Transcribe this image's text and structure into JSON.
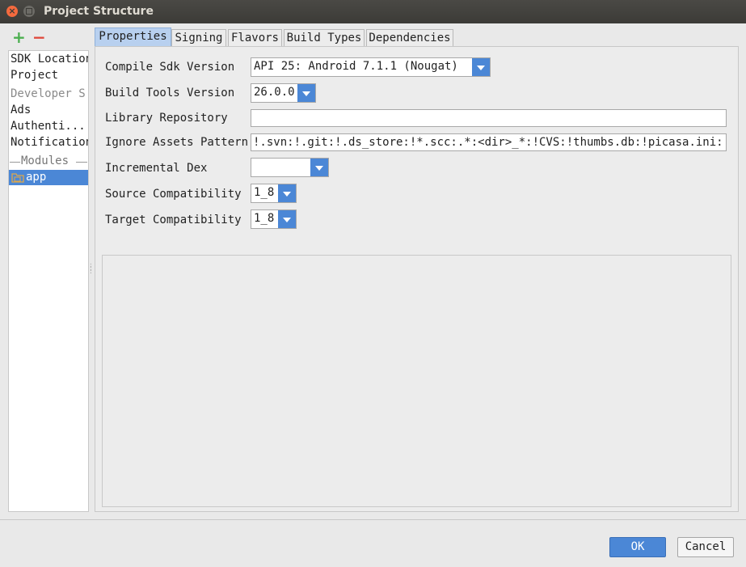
{
  "window": {
    "title": "Project Structure"
  },
  "toolbar": {
    "add": "+",
    "remove": "−"
  },
  "sidebar": {
    "items": [
      {
        "label": "SDK Location"
      },
      {
        "label": "Project"
      },
      {
        "label": "Developer S"
      },
      {
        "label": "Ads"
      },
      {
        "label": "Authenti..."
      },
      {
        "label": "Notification"
      }
    ],
    "section_label": "Modules",
    "modules": [
      {
        "label": "app"
      }
    ]
  },
  "tabs": [
    {
      "label": "Properties",
      "active": true
    },
    {
      "label": "Signing"
    },
    {
      "label": "Flavors"
    },
    {
      "label": "Build Types"
    },
    {
      "label": "Dependencies"
    }
  ],
  "form": {
    "compile_sdk": {
      "label": "Compile Sdk Version",
      "value": "API 25: Android 7.1.1 (Nougat)"
    },
    "build_tools": {
      "label": "Build Tools Version",
      "value": "26.0.0"
    },
    "library_repo": {
      "label": "Library Repository",
      "value": ""
    },
    "ignore_assets": {
      "label": "Ignore Assets Pattern",
      "value": "!.svn:!.git:!.ds_store:!*.scc:.*:<dir>_*:!CVS:!thumbs.db:!picasa.ini:!*~"
    },
    "incremental_dex": {
      "label": "Incremental Dex",
      "value": ""
    },
    "source_compat": {
      "label": "Source Compatibility",
      "value": "1_8"
    },
    "target_compat": {
      "label": "Target Compatibility",
      "value": "1_8"
    }
  },
  "buttons": {
    "ok": "OK",
    "cancel": "Cancel"
  },
  "colors": {
    "accent": "#4b87d6",
    "add": "#4caf50",
    "remove": "#e0483b",
    "close": "#f46a3e"
  }
}
